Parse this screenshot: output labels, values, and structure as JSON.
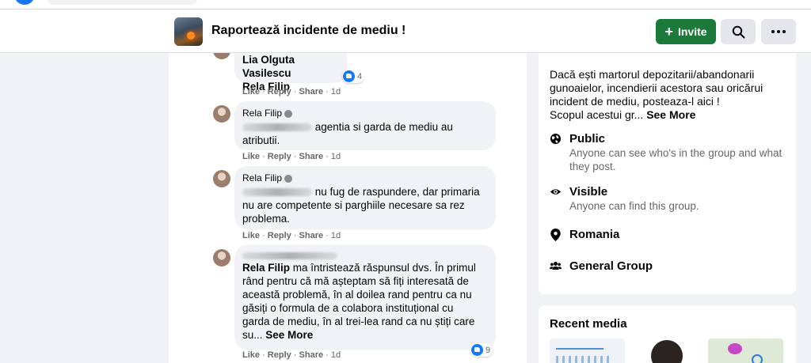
{
  "group": {
    "title": "Raportează incidente de mediu !",
    "invite_label": "Invite"
  },
  "comments": [
    {
      "names_line1": "Lia Olguta Vasilescu",
      "names_line2": "Rela Filip",
      "reaction_count": "4",
      "actions": {
        "like": "Like",
        "reply": "Reply",
        "share": "Share",
        "time": "1d"
      }
    },
    {
      "author": "Rela Filip",
      "text_line1": "agentia si garda de mediu au",
      "text_line2": "atributii.",
      "actions": {
        "like": "Like",
        "reply": "Reply",
        "share": "Share",
        "time": "1d"
      }
    },
    {
      "author": "Rela Filip",
      "text_line1": "nu fug de raspundere, dar primaria",
      "text_line2": "nu are competente si parghiile necesare sa rez",
      "text_line3": "problema.",
      "actions": {
        "like": "Like",
        "reply": "Reply",
        "share": "Share",
        "time": "1d"
      }
    },
    {
      "mention": "Rela Filip",
      "line1": "ma întristează răspunsul dvs. În primul",
      "line2": "rând pentru că mă așteptam să fiți interesată de",
      "line3": "această problemă, în al doilea rand pentru ca nu",
      "line4": "găsiți o formula de a colabora instituțional cu",
      "line5": "garda de mediu, în al trei-lea rand ca nu știți care",
      "line6": "su...",
      "see_more": "See More",
      "reaction_count": "9",
      "actions": {
        "like": "Like",
        "reply": "Reply",
        "share": "Share",
        "time": "1d"
      }
    }
  ],
  "about": {
    "desc_line1": "Dacă ești martorul depozitarii/abandonarii",
    "desc_line2": "gunoaielor, incendierii acestora sau oricărui",
    "desc_line3": "incident de mediu, posteaza-l aici !",
    "desc_line4": "Scopul acestui gr...",
    "see_more": "See More",
    "privacy_title": "Public",
    "privacy_sub": "Anyone can see who's in the group and what they post.",
    "visibility_title": "Visible",
    "visibility_sub": "Anyone can find this group.",
    "location": "Romania",
    "group_type": "General Group"
  },
  "media": {
    "title": "Recent media"
  },
  "icons": [
    "globe-icon",
    "eye-icon",
    "location-pin-icon",
    "people-icon",
    "search-icon",
    "more-icon",
    "like-icon",
    "wave-icon"
  ],
  "colors": {
    "invite_green": "#1b7a3a",
    "like_blue": "#1877f2",
    "bubble_gray": "#f0f2f5"
  }
}
